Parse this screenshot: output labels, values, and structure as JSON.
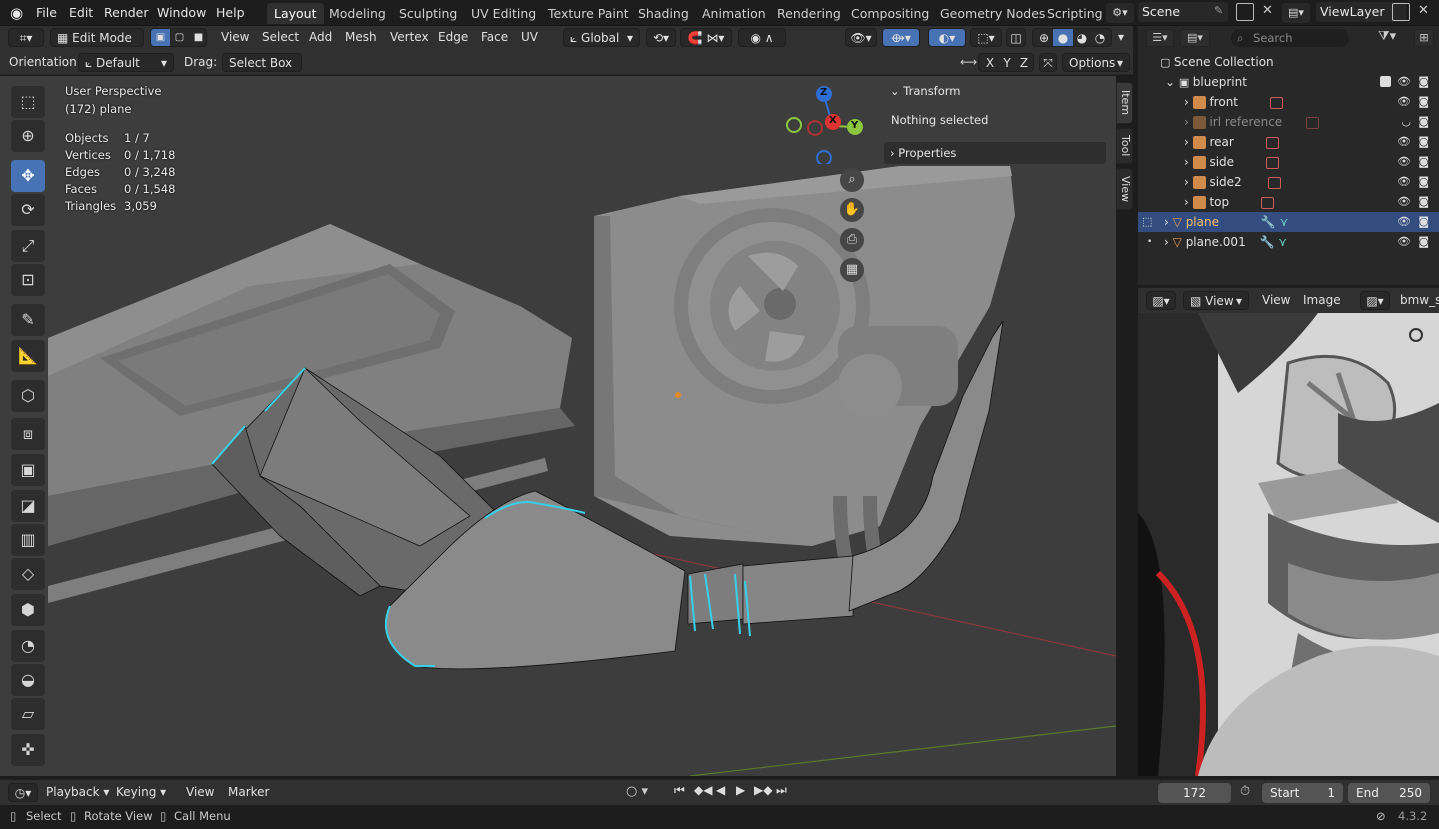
{
  "topbar": {
    "menus": [
      "File",
      "Edit",
      "Render",
      "Window",
      "Help"
    ],
    "workspaces": [
      "Layout",
      "Modeling",
      "Sculpting",
      "UV Editing",
      "Texture Paint",
      "Shading",
      "Animation",
      "Rendering",
      "Compositing",
      "Geometry Nodes",
      "Scripting"
    ],
    "active_workspace": "Layout",
    "scene": "Scene",
    "view_layer": "ViewLayer"
  },
  "header": {
    "mode": "Edit Mode",
    "menus": [
      "View",
      "Select",
      "Add",
      "Mesh",
      "Vertex",
      "Edge",
      "Face",
      "UV"
    ],
    "transform_orientation": "Global",
    "orientation_label": "Orientation:",
    "orientation_value": "Default",
    "drag_label": "Drag:",
    "drag_value": "Select Box",
    "axes": [
      "X",
      "Y",
      "Z"
    ],
    "options": "Options"
  },
  "viewport": {
    "perspective": "User Perspective",
    "object_info": "(172) plane",
    "stats": [
      {
        "label": "Objects",
        "value": "1 / 7"
      },
      {
        "label": "Vertices",
        "value": "0 / 1,718"
      },
      {
        "label": "Edges",
        "value": "0 / 3,248"
      },
      {
        "label": "Faces",
        "value": "0 / 1,548"
      },
      {
        "label": "Triangles",
        "value": "3,059"
      }
    ],
    "gizmo": {
      "z": "Z",
      "x": "X",
      "y": "Y"
    }
  },
  "npanel": {
    "transform": "Transform",
    "nothing_selected": "Nothing selected",
    "properties": "Properties",
    "tabs": [
      "Item",
      "Tool",
      "View"
    ]
  },
  "outliner": {
    "search_placeholder": "Search",
    "root": "Scene Collection",
    "collection": "blueprint",
    "items": [
      {
        "name": "front",
        "dim": false
      },
      {
        "name": "irl reference",
        "dim": true
      },
      {
        "name": "rear",
        "dim": false
      },
      {
        "name": "side",
        "dim": false
      },
      {
        "name": "side2",
        "dim": false
      },
      {
        "name": "top",
        "dim": false
      }
    ],
    "objects": [
      {
        "name": "plane",
        "selected": true
      },
      {
        "name": "plane.001",
        "selected": false
      }
    ]
  },
  "image_editor": {
    "menus": [
      "View",
      "View",
      "Image"
    ],
    "image_name": "bmw_s"
  },
  "timeline": {
    "menus": [
      "Playback",
      "Keying",
      "View",
      "Marker"
    ],
    "current_frame": "172",
    "start_label": "Start",
    "start": "1",
    "end_label": "End",
    "end": "250"
  },
  "statusbar": {
    "select": "Select",
    "rotate": "Rotate View",
    "menu": "Call Menu",
    "version": "4.3.2"
  }
}
